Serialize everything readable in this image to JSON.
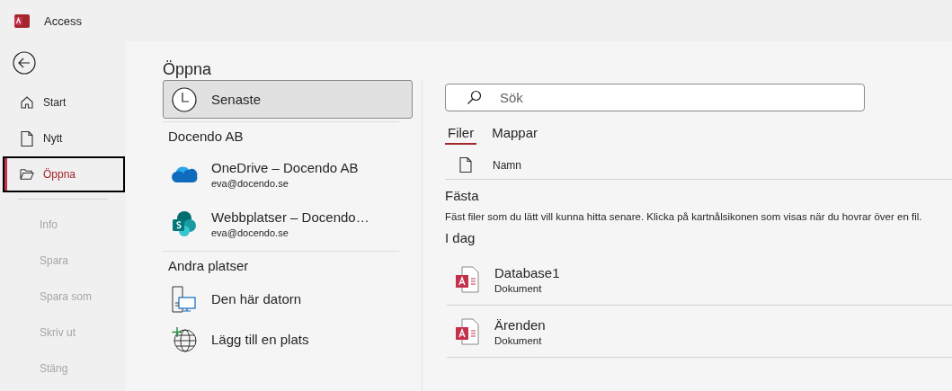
{
  "app": {
    "title": "Access"
  },
  "nav": {
    "items": [
      {
        "label": "Start",
        "selected": false,
        "disabled": false
      },
      {
        "label": "Nytt",
        "selected": false,
        "disabled": false
      },
      {
        "label": "Öppna",
        "selected": true,
        "disabled": false
      },
      {
        "label": "Info",
        "selected": false,
        "disabled": true
      },
      {
        "label": "Spara",
        "selected": false,
        "disabled": true
      },
      {
        "label": "Spara som",
        "selected": false,
        "disabled": true
      },
      {
        "label": "Skriv ut",
        "selected": false,
        "disabled": true
      },
      {
        "label": "Stäng",
        "selected": false,
        "disabled": true
      }
    ]
  },
  "page": {
    "title": "Öppna"
  },
  "locations": [
    {
      "kind": "button",
      "label": "Senaste",
      "selected": true
    },
    {
      "kind": "heading",
      "label": "Docendo AB"
    },
    {
      "kind": "account",
      "label": "OneDrive – Docendo AB",
      "account": "eva@docendo.se",
      "selected": false
    },
    {
      "kind": "account",
      "label": "Webbplatser – Docendo…",
      "account": "eva@docendo.se",
      "selected": false
    },
    {
      "kind": "heading",
      "label": "Andra platser"
    },
    {
      "kind": "place",
      "label": "Den här datorn",
      "selected": false
    },
    {
      "kind": "place",
      "label": "Lägg till en plats",
      "selected": false
    }
  ],
  "search": {
    "placeholder": "Sök"
  },
  "tabs": [
    {
      "label": "Filer",
      "selected": true
    },
    {
      "label": "Mappar",
      "selected": false
    }
  ],
  "file_list": {
    "name_column": "Namn",
    "sections": [
      {
        "title": "Fästa",
        "description": "Fäst filer som du lätt vill kunna hitta senare. Klicka på kartnålsikonen som visas när du hovrar över en fil."
      },
      {
        "title": "I dag",
        "files": [
          {
            "name": "Database1",
            "type": "Dokument"
          },
          {
            "name": "Ärenden",
            "type": "Dokument"
          }
        ]
      }
    ]
  }
}
